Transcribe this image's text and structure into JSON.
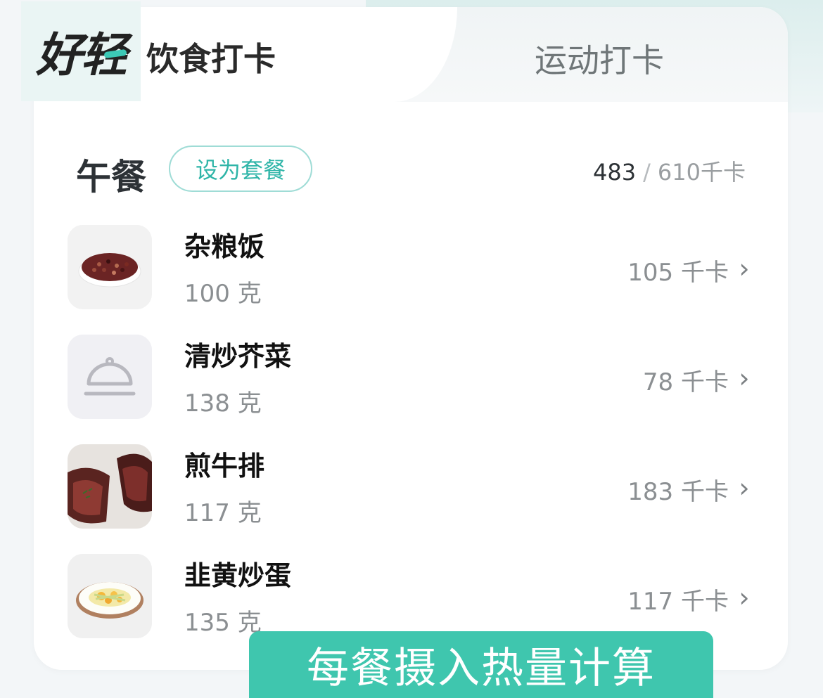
{
  "app": {
    "logo": "好轻"
  },
  "tabs": [
    {
      "label": "饮食打卡",
      "active": true
    },
    {
      "label": "运动打卡",
      "active": false
    }
  ],
  "meal": {
    "title": "午餐",
    "set_button": "设为套餐",
    "calories_current": "483",
    "calories_separator": "/",
    "calories_target": "610千卡"
  },
  "foods": [
    {
      "name": "杂粮饭",
      "quantity": "100 克",
      "calories": "105 千卡",
      "image": "multigrain-rice"
    },
    {
      "name": "清炒芥菜",
      "quantity": "138 克",
      "calories": "78 千卡",
      "image": "cloche-placeholder-icon"
    },
    {
      "name": "煎牛排",
      "quantity": "117 克",
      "calories": "183 千卡",
      "image": "steak"
    },
    {
      "name": "韭黄炒蛋",
      "quantity": "135 克",
      "calories": "117 千卡",
      "image": "chives-egg"
    }
  ],
  "banner": {
    "text": "每餐摄入热量计算"
  },
  "colors": {
    "accent": "#3fc6ae",
    "set_button_border": "#9fdcd6",
    "set_button_text": "#2fb5a8"
  }
}
